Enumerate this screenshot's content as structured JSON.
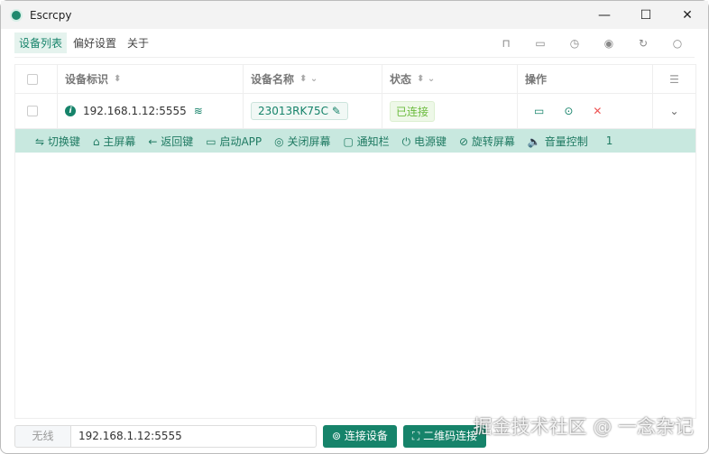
{
  "window": {
    "title": "Escrcpy",
    "minimize": "—",
    "maximize": "☐",
    "close": "✕"
  },
  "menu": [
    {
      "label": "设备列表",
      "active": true
    },
    {
      "label": "偏好设置"
    },
    {
      "label": "关于"
    }
  ],
  "toolbar_icons": [
    "presentation-icon",
    "terminal-icon",
    "clock-icon",
    "eye-icon",
    "refresh-icon",
    "search-icon"
  ],
  "table": {
    "headers": {
      "id": "设备标识",
      "name": "设备名称",
      "status": "状态",
      "ops": "操作"
    },
    "rows": [
      {
        "id": "192.168.1.12:5555",
        "name": "23013RK75C",
        "status": "已连接"
      }
    ]
  },
  "controls": [
    {
      "icon": "⇋",
      "label": "切换键"
    },
    {
      "icon": "⌂",
      "label": "主屏幕"
    },
    {
      "icon": "←",
      "label": "返回键"
    },
    {
      "icon": "▭",
      "label": "启动APP"
    },
    {
      "icon": "◎",
      "label": "关闭屏幕"
    },
    {
      "icon": "▢",
      "label": "通知栏"
    },
    {
      "icon": "⏻",
      "label": "电源键"
    },
    {
      "icon": "⊘",
      "label": "旋转屏幕"
    },
    {
      "icon": "🔈",
      "label": "音量控制"
    }
  ],
  "controls_more": "1",
  "bottom": {
    "mode": "无线",
    "address": "192.168.1.12:5555",
    "connect": "连接设备",
    "qr": "二维码连接"
  },
  "watermark": "掘金技术社区 @ 一念杂记",
  "colors": {
    "accent": "#16836a",
    "control_bar": "#c8e8df",
    "status_ok": "#6bbb3d",
    "danger": "#e55"
  }
}
